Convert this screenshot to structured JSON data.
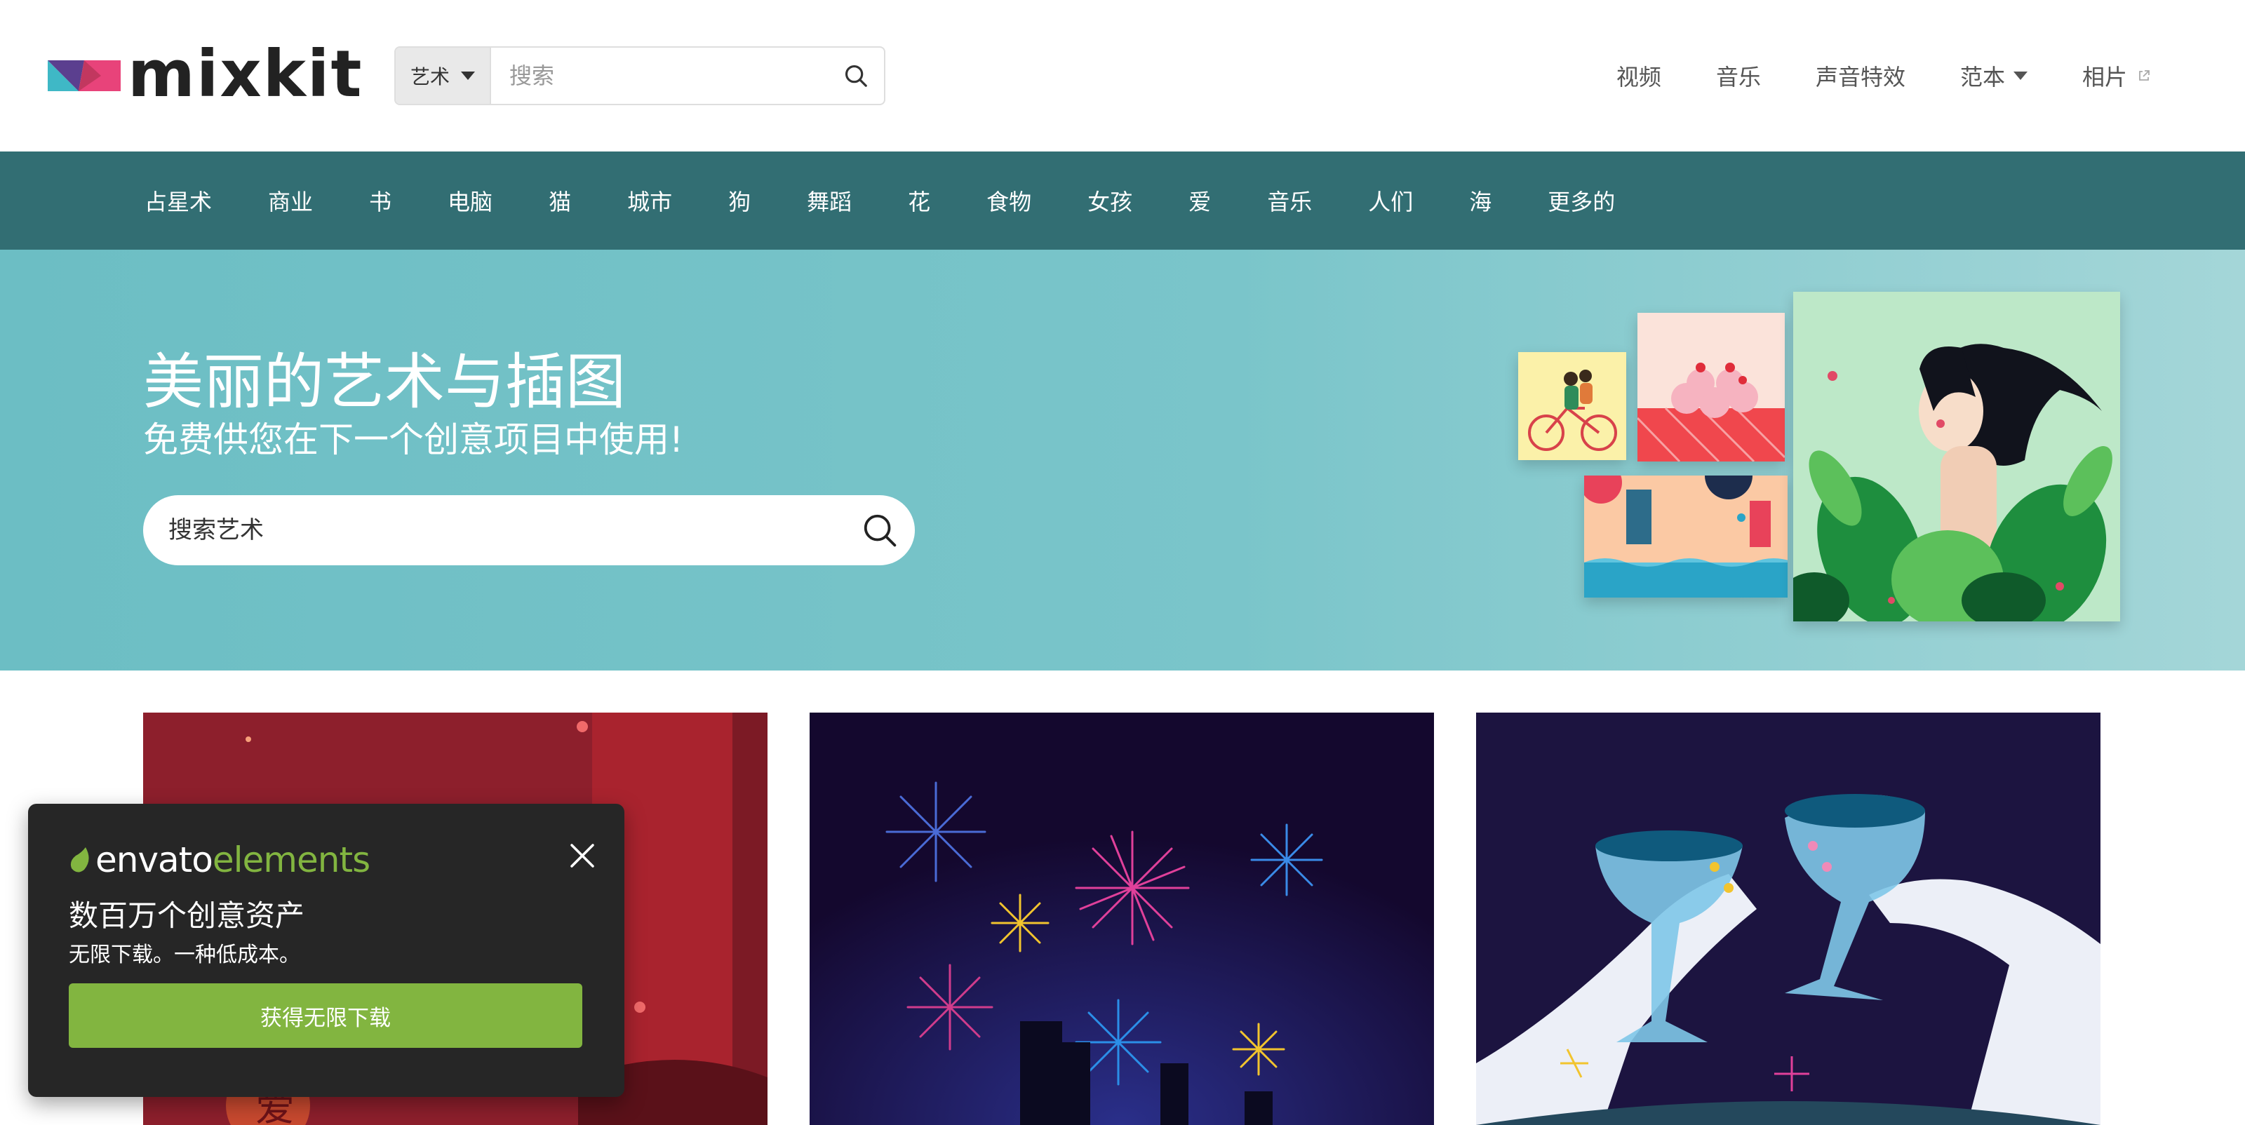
{
  "header": {
    "logo_text": "mixkit",
    "search": {
      "category_label": "艺术",
      "placeholder": "搜索"
    },
    "nav": [
      {
        "label": "视频"
      },
      {
        "label": "音乐"
      },
      {
        "label": "声音特效"
      },
      {
        "label": "范本",
        "dropdown": true
      },
      {
        "label": "相片",
        "external": true
      }
    ]
  },
  "categories": [
    "占星术",
    "商业",
    "书",
    "电脑",
    "猫",
    "城市",
    "狗",
    "舞蹈",
    "花",
    "食物",
    "女孩",
    "爱",
    "音乐",
    "人们",
    "海",
    "更多的"
  ],
  "hero": {
    "title": "美丽的艺术与插图",
    "subtitle": "免费供您在下一个创意项目中使用!",
    "search_placeholder": "搜索艺术"
  },
  "popup": {
    "brand_part1": "envato",
    "brand_part2": "elements",
    "title": "数百万个创意资产",
    "subtitle": "无限下载。一种低成本。",
    "button_label": "获得无限下载"
  },
  "colors": {
    "category_bar": "#326e73",
    "hero_bg": "#72c1c6",
    "envato_green": "#82b540",
    "popup_bg": "#262626"
  },
  "icons": {
    "search": "search-icon",
    "close": "close-icon",
    "dropdown": "caret-down-icon",
    "external": "external-link-icon"
  }
}
